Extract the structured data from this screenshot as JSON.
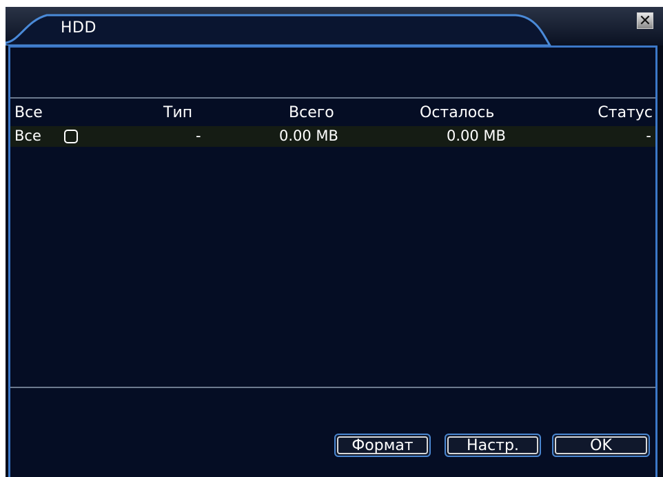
{
  "window": {
    "title": "HDD",
    "close_symbol": "✕",
    "close_icon": "close-icon"
  },
  "table": {
    "headers": [
      "Все",
      "Тип",
      "Всего",
      "Осталось",
      "Статус"
    ],
    "rows": [
      {
        "name": "Все",
        "type": "-",
        "total": "0.00 MB",
        "remaining": "0.00 MB",
        "status": "-",
        "checked": false
      }
    ]
  },
  "buttons": {
    "format_label": "Формат",
    "settings_label": "Настр.",
    "ok_label": "OK"
  },
  "colors": {
    "background": "#050d24",
    "accent_border": "#3c78c8",
    "row_highlight": "#151c14"
  }
}
